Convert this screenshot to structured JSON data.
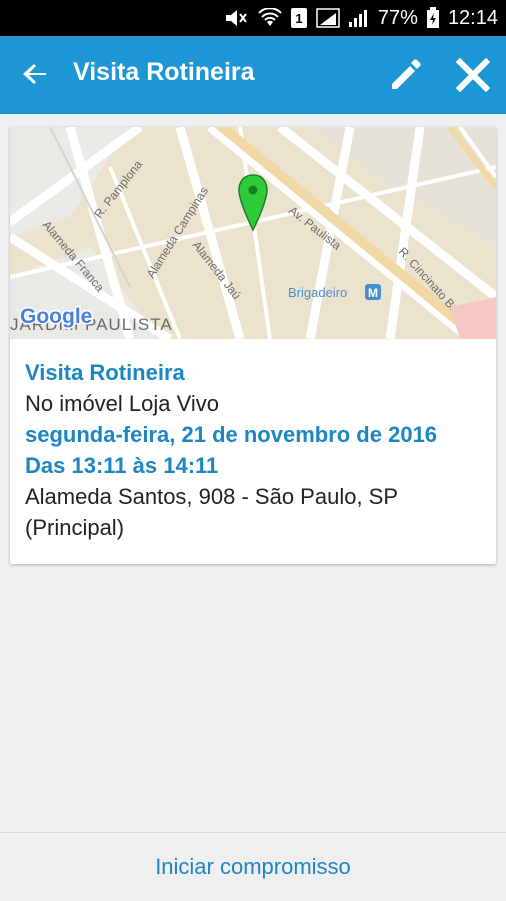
{
  "status_bar": {
    "battery": "77%",
    "time": "12:14",
    "sim_label": "1"
  },
  "header": {
    "title": "Visita Rotineira",
    "back_icon": "arrow-back-icon",
    "edit_icon": "pencil-icon",
    "close_icon": "close-icon",
    "color": "#1c96d4"
  },
  "map": {
    "streets": [
      "R. Pamplona",
      "Alameda Campinas",
      "Av. Paulista",
      "Alameda Franca",
      "Alameda Jaú",
      "R. Cincinato Braga"
    ],
    "station": "Brigadeiro",
    "metro_badge": "M",
    "district": "JARDIM PAULISTA",
    "logo": "Google",
    "pin_color": "#2ecc3a"
  },
  "event": {
    "title": "Visita Rotineira",
    "property": "No imóvel Loja Vivo",
    "date": "segunda-feira, 21 de novembro de 2016",
    "time_range": "Das 13:11 às 14:11",
    "address_line1": "Alameda Santos, 908 - São Paulo, SP",
    "address_line2": "(Principal)"
  },
  "footer": {
    "action_label": "Iniciar compromisso"
  },
  "colors": {
    "accent": "#1c86c4",
    "background": "#efefef"
  }
}
